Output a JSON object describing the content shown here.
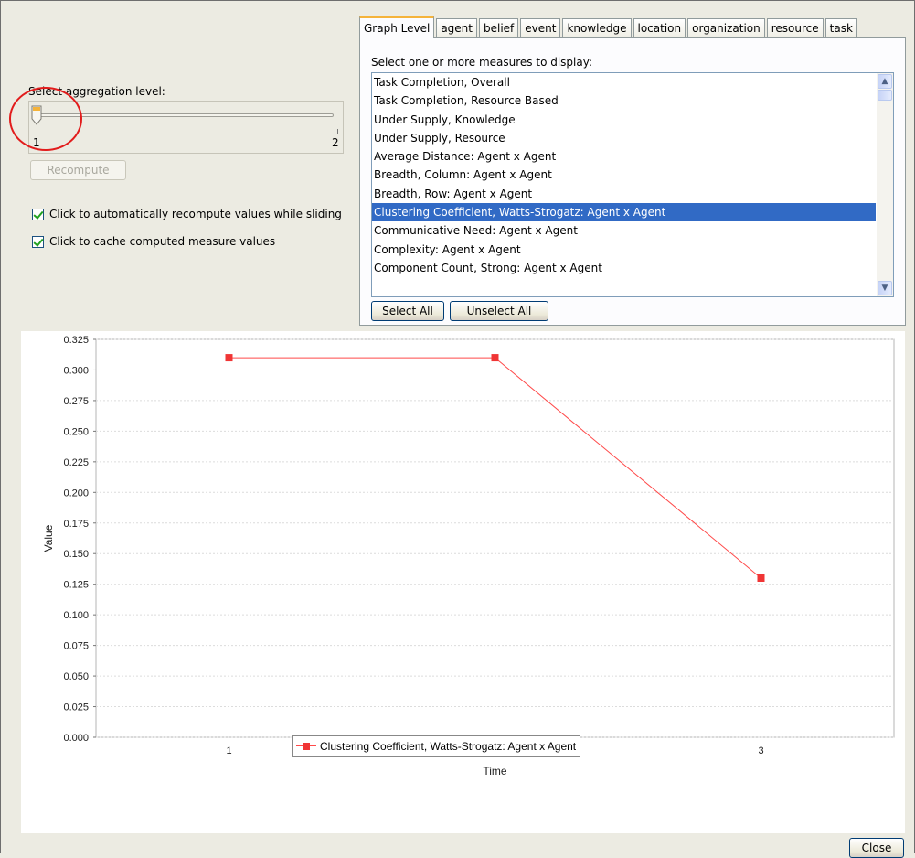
{
  "aggregation": {
    "label": "Select aggregation level:",
    "min_label": "1",
    "max_label": "2",
    "value": 1,
    "recompute_label": "Recompute",
    "recompute_enabled": false
  },
  "options": {
    "auto_recompute_label": "Click to automatically recompute values while sliding",
    "auto_recompute_checked": true,
    "cache_label": "Click to cache computed measure values",
    "cache_checked": true
  },
  "tabs": [
    {
      "label": "Graph Level",
      "active": true
    },
    {
      "label": "agent"
    },
    {
      "label": "belief"
    },
    {
      "label": "event"
    },
    {
      "label": "knowledge"
    },
    {
      "label": "location"
    },
    {
      "label": "organization"
    },
    {
      "label": "resource"
    },
    {
      "label": "task"
    }
  ],
  "measures": {
    "caption": "Select one or more measures to display:",
    "items": [
      "Task Completion, Overall",
      "Task Completion, Resource Based",
      "Under Supply, Knowledge",
      "Under Supply, Resource",
      "Average Distance: Agent x Agent",
      "Breadth, Column: Agent x Agent",
      "Breadth, Row: Agent x Agent",
      "Clustering Coefficient, Watts-Strogatz: Agent x Agent",
      "Communicative Need: Agent x Agent",
      "Complexity: Agent x Agent",
      "Component Count, Strong: Agent x Agent"
    ],
    "selected_index": 7,
    "select_all_label": "Select All",
    "unselect_all_label": "Unselect All"
  },
  "chart_data": {
    "type": "line",
    "xlabel": "Time",
    "ylabel": "Value",
    "x": [
      1,
      2,
      3
    ],
    "ylim": [
      0,
      0.325
    ],
    "y_ticks": [
      "0.000",
      "0.025",
      "0.050",
      "0.075",
      "0.100",
      "0.125",
      "0.150",
      "0.175",
      "0.200",
      "0.225",
      "0.250",
      "0.275",
      "0.300",
      "0.325"
    ],
    "x_ticks": [
      "1",
      "2",
      "3"
    ],
    "grid": true,
    "legend_position": "bottom-center",
    "series": [
      {
        "name": "Clustering Coefficient, Watts-Strogatz: Agent x Agent",
        "values": [
          0.31,
          0.31,
          0.13
        ],
        "color": "#ff4a4a"
      }
    ]
  },
  "close_label": "Close"
}
